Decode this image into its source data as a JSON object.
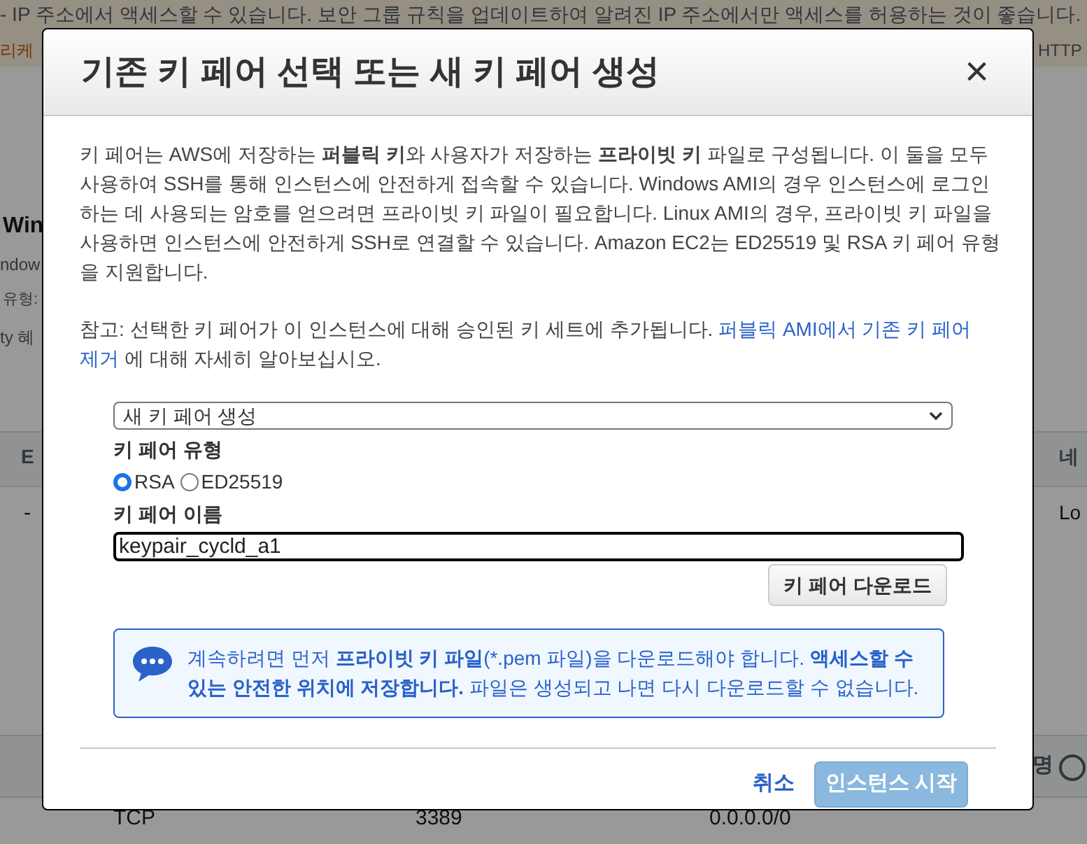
{
  "background": {
    "fragments": [
      {
        "text": "- IP 주소에서 액세스할 수 있습니다. 보안 그룹 규칙을 업데이트하여 알려진 IP 주소에서만 액세스를 허용하는 것이 좋습니다."
      },
      {
        "text": "리케"
      },
      {
        "text": "HTTP"
      },
      {
        "text": "Win"
      },
      {
        "text": "ndow"
      },
      {
        "text": "유형:"
      },
      {
        "text": "ty 혜"
      },
      {
        "text": "E"
      },
      {
        "text": "네"
      },
      {
        "text": "-"
      },
      {
        "text": "Lo"
      },
      {
        "text": "명"
      },
      {
        "text": "TCP"
      },
      {
        "text": "3389"
      },
      {
        "text": "0.0.0.0/0"
      }
    ]
  },
  "dialog": {
    "title": "기존 키 페어 선택 또는 새 키 페어 생성",
    "close": "×",
    "description": "키 페어는 AWS에 저장하는 **퍼블릭 키**와 사용자가 저장하는 **프라이빗 키** 파일로 구성됩니다. 이 둘을 모두 사용하여 SSH를 통해 인스턴스에 안전하게 접속할 수 있습니다. Windows AMI의 경우 인스턴스에 로그인하는 데 사용되는 암호를 얻으려면 프라이빗 키 파일이 필요합니다. Linux AMI의 경우, 프라이빗 키 파일을 사용하면 인스턴스에 안전하게 SSH로 연결할 수 있습니다. Amazon EC2는 ED25519 및 RSA 키 페어 유형을 지원합니다.",
    "note": "참고: 선택한 키 페어가 이 인스턴스에 대해 승인된 키 세트에 추가됩니다.",
    "note_link_1": "퍼블릭 AMI에서 기존 키 페어",
    "note_link_2": "제거",
    "note_tail": "에 대해 자세히 알아보십시오.",
    "key_pair_select": {
      "value": "새 키 페어 생성"
    },
    "key_type_label": "키 페어 유형",
    "key_types": [
      {
        "label": "RSA",
        "selected": true
      },
      {
        "label": "ED25519",
        "selected": false
      }
    ],
    "key_name_label": "키 페어 이름",
    "key_name": {
      "value": "keypair_cycld_a1"
    },
    "download_button": "키 페어 다운로드",
    "info": "계속하려면 먼저 **프라이빗 키 파일**(*.pem 파일)을 다운로드해야 합니다. **액세스할 수 있는 안전한 위치에 저장합니다.** 파일은 생성되고 나면 다시 다운로드할 수 없습니다.",
    "cancel": "취소",
    "launch": {
      "label": "인스턴스 시작",
      "disabled": true
    }
  }
}
